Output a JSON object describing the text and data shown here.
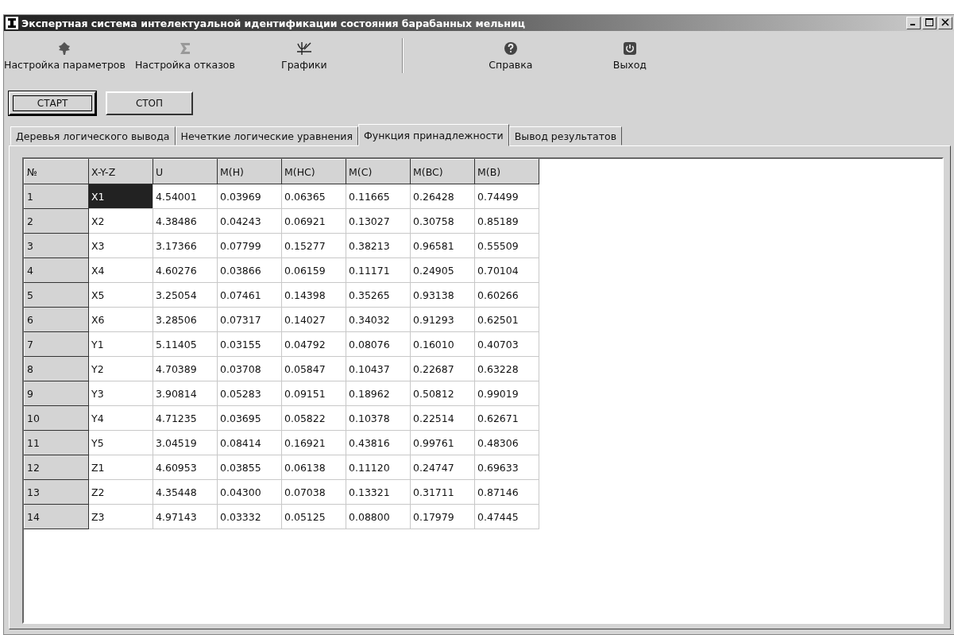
{
  "window": {
    "title": "Экспертная система интелектуальной идентификации состояния барабанных мельниц"
  },
  "toolbar": [
    {
      "kind": "tree",
      "label": "Настройка параметров"
    },
    {
      "kind": "sigma",
      "label": "Настройка отказов"
    },
    {
      "kind": "chart",
      "label": "Графики"
    },
    {
      "kind": "separator"
    },
    {
      "kind": "help",
      "label": "Справка"
    },
    {
      "kind": "power",
      "label": "Выход"
    }
  ],
  "buttons": [
    {
      "label": "СТАРТ",
      "focused": true
    },
    {
      "label": "СТОП",
      "focused": false
    }
  ],
  "tabs": [
    {
      "label": "Деревья логического вывода",
      "selected": false
    },
    {
      "label": "Нечеткие логические уравнения",
      "selected": false
    },
    {
      "label": "Функция принадлежности",
      "selected": true
    },
    {
      "label": "Вывод результатов",
      "selected": false
    }
  ],
  "table": {
    "columns": [
      "№",
      "X-Y-Z",
      "U",
      "M(H)",
      "M(HC)",
      "M(C)",
      "M(BC)",
      "M(B)"
    ],
    "rows": [
      {
        "cells": [
          "1",
          "X1",
          "4.54001",
          "0.03969",
          "0.06365",
          "0.11665",
          "0.26428",
          "0.74499"
        ],
        "selected": true
      },
      {
        "cells": [
          "2",
          "X2",
          "4.38486",
          "0.04243",
          "0.06921",
          "0.13027",
          "0.30758",
          "0.85189"
        ],
        "selected": false
      },
      {
        "cells": [
          "3",
          "X3",
          "3.17366",
          "0.07799",
          "0.15277",
          "0.38213",
          "0.96581",
          "0.55509"
        ],
        "selected": false
      },
      {
        "cells": [
          "4",
          "X4",
          "4.60276",
          "0.03866",
          "0.06159",
          "0.11171",
          "0.24905",
          "0.70104"
        ],
        "selected": false
      },
      {
        "cells": [
          "5",
          "X5",
          "3.25054",
          "0.07461",
          "0.14398",
          "0.35265",
          "0.93138",
          "0.60266"
        ],
        "selected": false
      },
      {
        "cells": [
          "6",
          "X6",
          "3.28506",
          "0.07317",
          "0.14027",
          "0.34032",
          "0.91293",
          "0.62501"
        ],
        "selected": false
      },
      {
        "cells": [
          "7",
          "Y1",
          "5.11405",
          "0.03155",
          "0.04792",
          "0.08076",
          "0.16010",
          "0.40703"
        ],
        "selected": false
      },
      {
        "cells": [
          "8",
          "Y2",
          "4.70389",
          "0.03708",
          "0.05847",
          "0.10437",
          "0.22687",
          "0.63228"
        ],
        "selected": false
      },
      {
        "cells": [
          "9",
          "Y3",
          "3.90814",
          "0.05283",
          "0.09151",
          "0.18962",
          "0.50812",
          "0.99019"
        ],
        "selected": false
      },
      {
        "cells": [
          "10",
          "Y4",
          "4.71235",
          "0.03695",
          "0.05822",
          "0.10378",
          "0.22514",
          "0.62671"
        ],
        "selected": false
      },
      {
        "cells": [
          "11",
          "Y5",
          "3.04519",
          "0.08414",
          "0.16921",
          "0.43816",
          "0.99761",
          "0.48306"
        ],
        "selected": false
      },
      {
        "cells": [
          "12",
          "Z1",
          "4.60953",
          "0.03855",
          "0.06138",
          "0.11120",
          "0.24747",
          "0.69633"
        ],
        "selected": false
      },
      {
        "cells": [
          "13",
          "Z2",
          "4.35448",
          "0.04300",
          "0.07038",
          "0.13321",
          "0.31711",
          "0.87146"
        ],
        "selected": false
      },
      {
        "cells": [
          "14",
          "Z3",
          "4.97143",
          "0.03332",
          "0.05125",
          "0.08800",
          "0.17979",
          "0.47445"
        ],
        "selected": false
      }
    ]
  }
}
